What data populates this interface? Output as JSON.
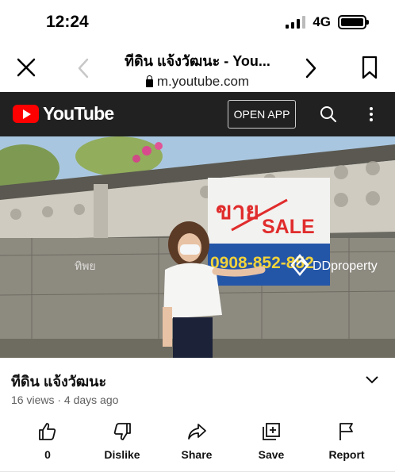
{
  "status": {
    "time": "12:24",
    "network": "4G"
  },
  "browser": {
    "title": "ทีดิน แจ้งวัฒนะ - You...",
    "url": "m.youtube.com"
  },
  "youtube": {
    "logo_text": "YouTube",
    "open_app_label": "OPEN APP"
  },
  "video": {
    "sign_top_text": "ขาย",
    "sign_sale_text": "SALE",
    "sign_phone": "0908-852-852",
    "watermark_left": "ทิพย",
    "watermark_brand": "DDproperty"
  },
  "details": {
    "title": "ทีดิน แจ้งวัฒนะ",
    "meta": "16 views · 4 days ago"
  },
  "actions": [
    {
      "label": "0",
      "icon": "thumbs-up-icon"
    },
    {
      "label": "Dislike",
      "icon": "thumbs-down-icon"
    },
    {
      "label": "Share",
      "icon": "share-icon"
    },
    {
      "label": "Save",
      "icon": "save-playlist-icon"
    },
    {
      "label": "Report",
      "icon": "flag-icon"
    }
  ],
  "colors": {
    "yt_red": "#ff0000",
    "header_bg": "#212121"
  }
}
